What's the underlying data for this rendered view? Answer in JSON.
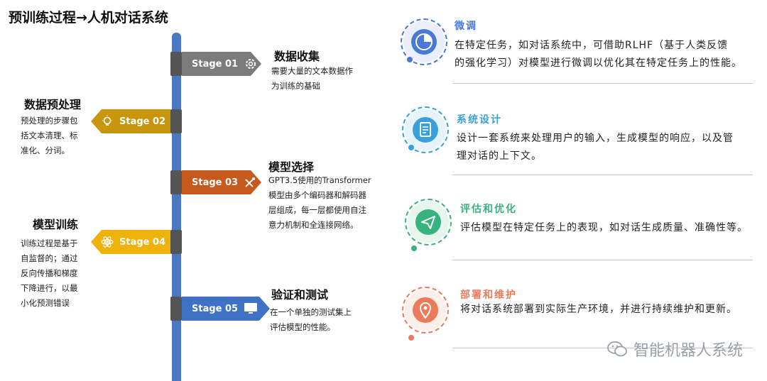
{
  "title": "预训练过程→人机对话系统",
  "stages": [
    {
      "label": "Stage 01",
      "icon": "gear-icon",
      "color": "#7b7b7b",
      "heading": "数据收集",
      "desc": [
        "需要大量的文本数据作",
        "为训练的基础"
      ]
    },
    {
      "label": "Stage 02",
      "icon": "lightbulb-icon",
      "color": "#c8960e",
      "heading": "数据预处理",
      "desc": [
        "预处理的步骤包",
        "括文本清理、标",
        "准化、分词。"
      ]
    },
    {
      "label": "Stage 03",
      "icon": "satellite-icon",
      "color": "#c65a1e",
      "heading": "模型选择",
      "desc": [
        "GPT3.5使用的Transformer",
        "模型由多个编码器和解码器",
        "层组成，每一层都使用自注",
        "意力机制和全连接网络。"
      ]
    },
    {
      "label": "Stage 04",
      "icon": "atom-icon",
      "color": "#efb20d",
      "heading": "模型训练",
      "desc": [
        "训练过程是基于",
        "自监督的；通过",
        "反向传播和梯度",
        "下降进行，以最",
        "小化预测错误"
      ]
    },
    {
      "label": "Stage 05",
      "icon": "monitor-icon",
      "color": "#3f72c4",
      "heading": "验证和测试",
      "desc": [
        "在一个单独的测试集上",
        "评估模型的性能。"
      ]
    }
  ],
  "right_items": [
    {
      "title": "微调",
      "icon": "pie-chart-icon",
      "color": "#4a78d6",
      "text": [
        "在特定任务，如对话系统中，可借助RLHF（基于人类反馈",
        "的强化学习）对模型进行微调以优化其在特定任务上的性能。"
      ]
    },
    {
      "title": "系统设计",
      "icon": "document-icon",
      "color": "#3aa0d9",
      "text": [
        "设计一套系统来处理用户的输入，生成模型的响应，以及管",
        "理对话的上下文。"
      ]
    },
    {
      "title": "评估和优化",
      "icon": "send-icon",
      "color": "#36b37e",
      "text": [
        "评估模型在特定任务上的表现，如对话生成质量、准确性等。"
      ]
    },
    {
      "title": "部署和维护",
      "icon": "location-icon",
      "color": "#ec7a5c",
      "text": [
        "将对话系统部署到实际生产环境，并进行持续维护和更新。"
      ]
    }
  ],
  "watermark": "智能机器人系统"
}
